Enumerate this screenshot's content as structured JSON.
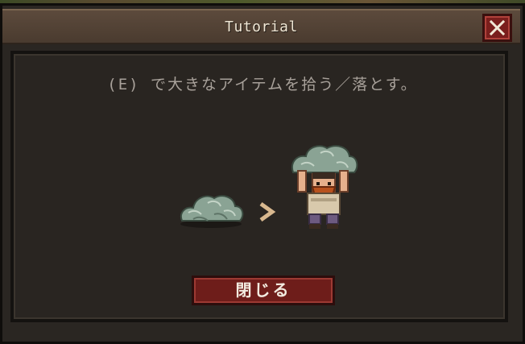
{
  "window": {
    "title": "Tutorial",
    "close_icon": "close-x-icon"
  },
  "content": {
    "instruction": "(E) で大きなアイテムを拾う／落とす。",
    "illustration": {
      "left_item": "large-item-pile-icon",
      "arrow": "arrow-right-icon",
      "right_item": "character-carrying-item-icon"
    }
  },
  "footer": {
    "close_button_label": "閉じる"
  },
  "colors": {
    "accent_red": "#7a1e1c",
    "title_bar": "#54443a",
    "panel_bg": "#292521",
    "text": "#a8a19a"
  }
}
